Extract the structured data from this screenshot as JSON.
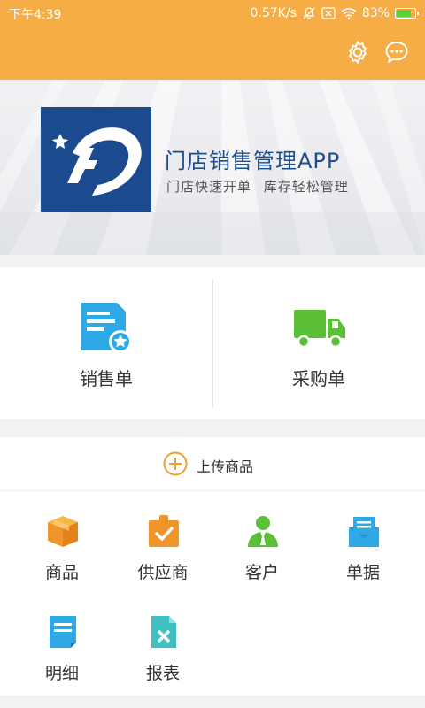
{
  "status_bar": {
    "time": "下午4:39",
    "network_speed": "0.57K/s",
    "battery_percent": "83%",
    "battery_level": 0.83,
    "icons": [
      "mute-bell-icon",
      "sim-icon",
      "wifi-icon",
      "battery-icon"
    ]
  },
  "header": {
    "bg_color": "#f7ad45",
    "actions": [
      {
        "name": "settings",
        "icon": "gear-icon"
      },
      {
        "name": "messages",
        "icon": "chat-bubble-icon"
      }
    ]
  },
  "banner": {
    "title": "门店销售管理APP",
    "subtitle": "门店快速开单  库存轻松管理",
    "logo_color": "#1b4a8e"
  },
  "primary_actions": [
    {
      "label": "销售单",
      "icon": "sales-order-icon",
      "color": "#2fa9e6"
    },
    {
      "label": "采购单",
      "icon": "delivery-truck-icon",
      "color": "#5cbf38"
    }
  ],
  "upload": {
    "label": "上传商品",
    "icon": "plus-circle-icon",
    "color": "#f0a02e"
  },
  "grid": [
    {
      "label": "商品",
      "icon": "box-icon"
    },
    {
      "label": "供应商",
      "icon": "supplier-badge-icon"
    },
    {
      "label": "客户",
      "icon": "customer-icon"
    },
    {
      "label": "单据",
      "icon": "envelope-icon"
    },
    {
      "label": "明细",
      "icon": "detail-document-icon"
    },
    {
      "label": "报表",
      "icon": "spreadsheet-icon"
    }
  ]
}
